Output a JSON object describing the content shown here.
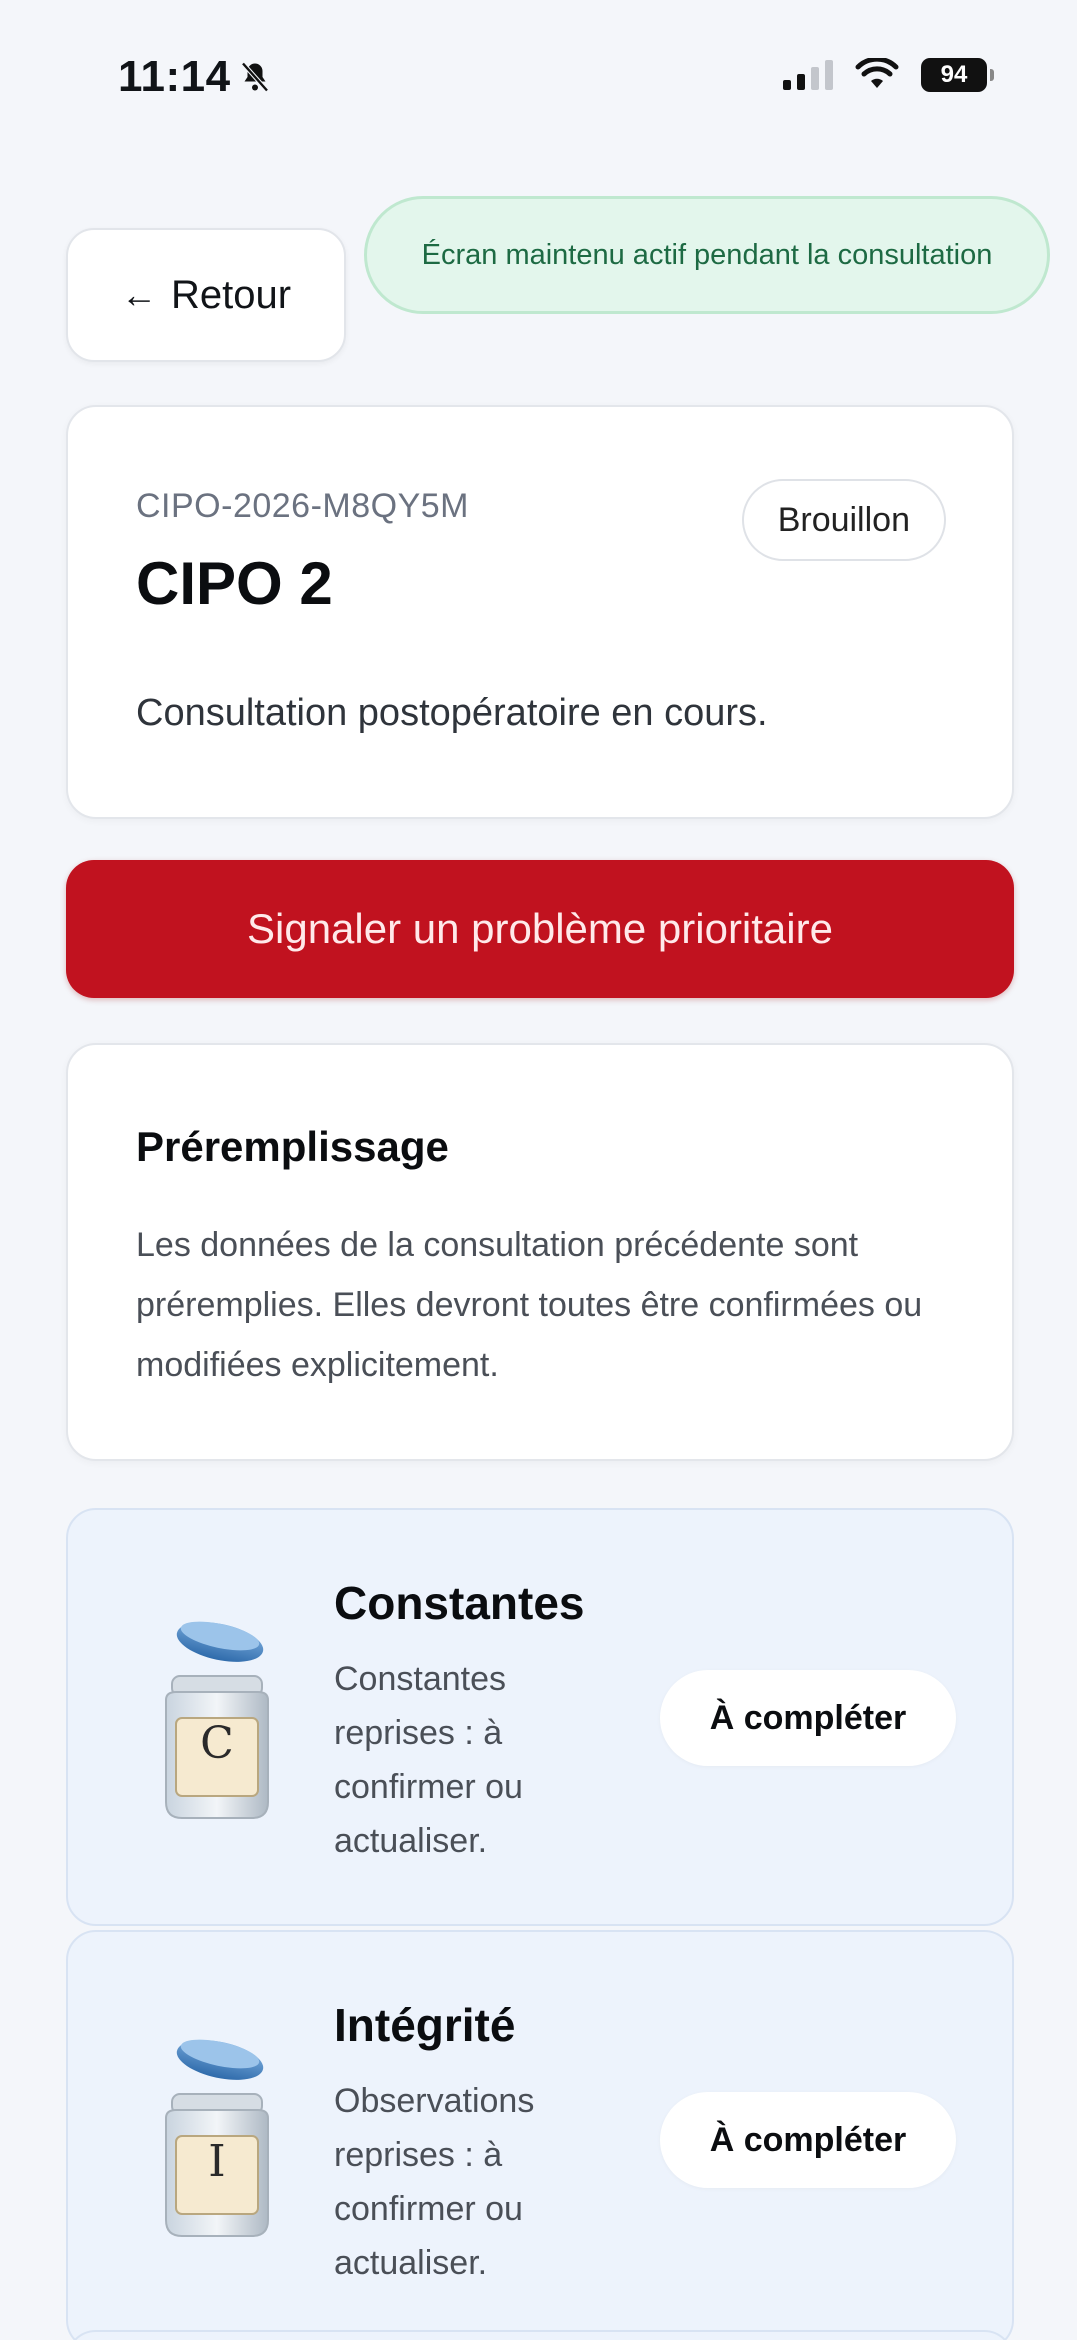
{
  "status_bar": {
    "time": "11:14",
    "battery": "94"
  },
  "header": {
    "back_label": "Retour",
    "wake_notice": "Écran maintenu actif pendant la consultation"
  },
  "record": {
    "reference": "CIPO-2026-M8QY5M",
    "status": "Brouillon",
    "title": "CIPO 2",
    "description": "Consultation postopératoire en cours."
  },
  "priority_button": "Signaler un problème prioritaire",
  "prefill": {
    "title": "Préremplissage",
    "text": "Les données de la consultation précédente sont préremplies. Elles devront toutes être confirmées ou modifiées explicitement."
  },
  "sections": [
    {
      "jar_letter": "C",
      "title": "Constantes",
      "description": "Constantes reprises : à confirmer ou actualiser.",
      "action": "À compléter"
    },
    {
      "jar_letter": "I",
      "title": "Intégrité",
      "description": "Observations reprises : à confirmer ou actualiser.",
      "action": "À compléter"
    }
  ],
  "colors": {
    "priority": "#c1121f",
    "notice_bg": "#e3f6ec",
    "notice_text": "#1d6a43",
    "section_bg": "#edf3fc"
  }
}
